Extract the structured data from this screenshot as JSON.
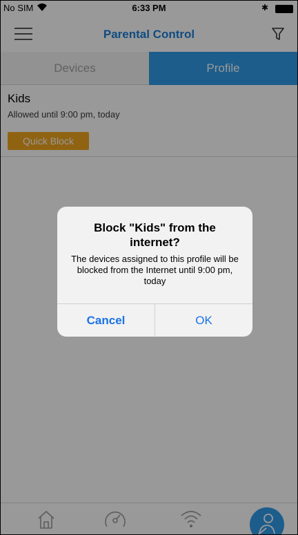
{
  "status_bar": {
    "carrier": "No SIM",
    "time": "6:33 PM",
    "bluetooth_symbol": "✱"
  },
  "nav": {
    "title": "Parental Control"
  },
  "tabs": [
    {
      "label": "Devices",
      "active": false
    },
    {
      "label": "Profile",
      "active": true
    }
  ],
  "profile": {
    "name": "Kids",
    "status": "Allowed until 9:00 pm, today",
    "quick_block_label": "Quick Block"
  },
  "dialog": {
    "title": "Block \"Kids\" from the internet?",
    "message": "The devices assigned to this profile will be blocked from the Internet until 9:00 pm, today",
    "cancel_label": "Cancel",
    "ok_label": "OK"
  },
  "bottom_tabs": [
    {
      "icon": "home-icon",
      "active": false
    },
    {
      "icon": "speedometer-icon",
      "active": false
    },
    {
      "icon": "wifi-icon",
      "active": false
    },
    {
      "icon": "parental-control-icon",
      "active": true
    }
  ],
  "colors": {
    "accent": "#2f9bea",
    "title_blue": "#1d7fd8",
    "quick_block": "#f1a51f",
    "dialog_button": "#1a73e8"
  }
}
